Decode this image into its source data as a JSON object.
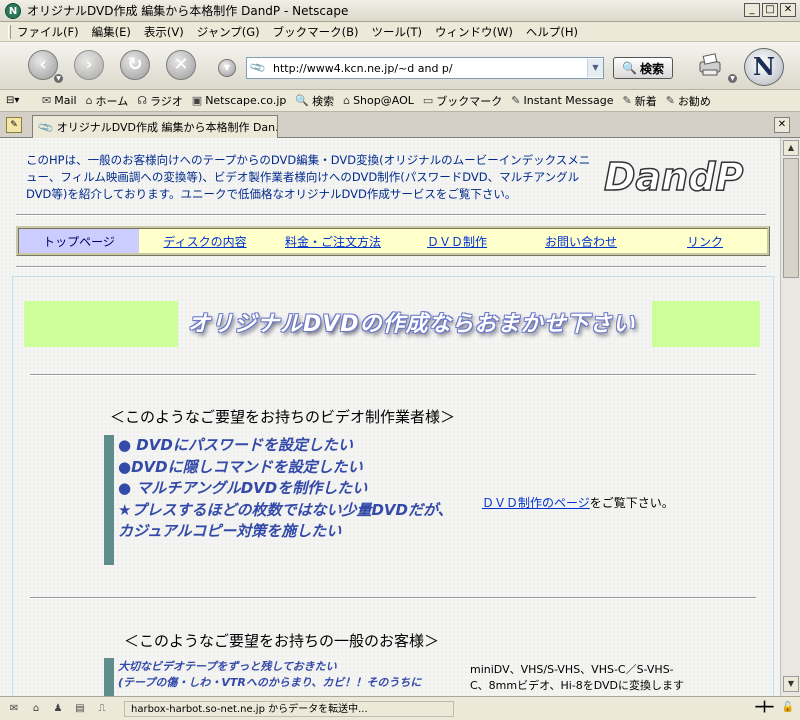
{
  "window": {
    "title": "オリジナルDVD作成 編集から本格制作 DandP - Netscape",
    "btn_min": "_",
    "btn_max": "□",
    "btn_close": "✕"
  },
  "menu": [
    "ファイル(F)",
    "編集(E)",
    "表示(V)",
    "ジャンプ(G)",
    "ブックマーク(B)",
    "ツール(T)",
    "ウィンドウ(W)",
    "ヘルプ(H)"
  ],
  "toolbar": {
    "url": "http://www4.kcn.ne.jp/~d and p/",
    "search_label": "検索"
  },
  "personal_toolbar": [
    "Mail",
    "ホーム",
    "ラジオ",
    "Netscape.co.jp",
    "検索",
    "Shop@AOL",
    "ブックマーク",
    "Instant Message",
    "新着",
    "お勧め"
  ],
  "tab": {
    "label": "オリジナルDVD作成 編集から本格制作 Dan..."
  },
  "page": {
    "intro": "このHPは、一般のお客様向けへのテープからのDVD編集・DVD変換(オリジナルのムービーインデックスメニュー、フィルム映画調への変換等)、ビデオ製作業者様向けへのDVD制作(パスワードDVD、マルチアングルDVD等)を紹介しております。ユニークで低価格なオリジナルDVD作成サービスをご覧下さい。",
    "logo_text": "DandP",
    "nav": [
      "トップページ",
      "ディスクの内容",
      "料金・ご注文方法",
      "ＤＶＤ制作",
      "お問い合わせ",
      "リンク"
    ],
    "banner": "オリジナルDVDの作成ならおまかせ下さい",
    "section1_heading": "＜このようなご要望をお持ちのビデオ制作業者様＞",
    "section1_bullets": [
      "● DVDにパスワードを設定したい",
      "●DVDに隠しコマンドを設定したい",
      "● マルチアングルDVDを制作したい",
      "★プレスするほどの枚数ではない少量DVDだが、",
      "カジュアルコピー対策を施したい"
    ],
    "dvd_link": "ＤＶＤ制作のページ",
    "dvd_link_suffix": "をご覧下さい。",
    "section2_heading": "＜このようなご要望をお持ちの一般のお客様＞",
    "section2_line1": "大切なビデオテープをずっと残しておきたい",
    "section2_line2": "(テープの傷・しわ・VTRへのからまり、カビ！！そのうちに",
    "formats": "miniDV、VHS/S-VHS、VHS-C／S-VHS-C、8mmビデオ、Hi-8をDVDに変換します"
  },
  "status": {
    "text": "harbox-harbot.so-net.ne.jp からデータを転送中..."
  }
}
